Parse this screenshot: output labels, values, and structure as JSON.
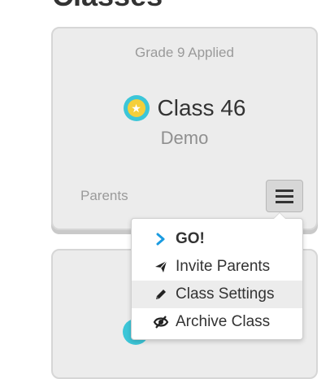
{
  "page": {
    "heading": "Classes"
  },
  "card": {
    "grade": "Grade 9 Applied",
    "class_name": "Class 46",
    "subtitle": "Demo",
    "parents_label": "Parents"
  },
  "dropdown": {
    "items": [
      {
        "label": "GO!",
        "icon": "chevron-right-icon"
      },
      {
        "label": "Invite Parents",
        "icon": "send-icon"
      },
      {
        "label": "Class Settings",
        "icon": "pencil-icon"
      },
      {
        "label": "Archive Class",
        "icon": "eye-slash-icon"
      }
    ]
  },
  "colors": {
    "card_bg": "#ececec",
    "avatar": "#3cc6d8",
    "star": "#f5cf3a",
    "go_chevron": "#1a9be0",
    "highlight_row": "#ececec"
  }
}
